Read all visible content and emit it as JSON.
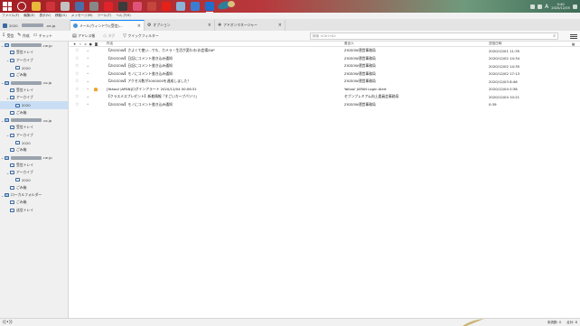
{
  "taskbar": {
    "apps": [
      {
        "icon": "folder-app-icon",
        "color": "#e8b93a"
      },
      {
        "icon": "red-app-icon",
        "color": "#d0343b"
      },
      {
        "icon": "tile-app-icon",
        "color": "#c2c2c2"
      },
      {
        "icon": "save-app-icon",
        "color": "#4a6fa8"
      },
      {
        "icon": "gear-app-icon",
        "color": "#888888"
      },
      {
        "icon": "opera-app-icon",
        "color": "#e1232a"
      },
      {
        "icon": "cmd-app-icon",
        "color": "#3b3b3b"
      },
      {
        "icon": "pink-app-icon",
        "color": "#e05277"
      },
      {
        "icon": "globe-app-icon",
        "color": "#c4463c"
      },
      {
        "icon": "youtube-app-icon",
        "color": "#e62117"
      },
      {
        "icon": "image-app-icon",
        "color": "#8ab4d8"
      },
      {
        "icon": "calendar-app-icon",
        "color": "#3c7dd4"
      },
      {
        "icon": "thunderbird-app-icon",
        "color": "#1f6fcf"
      }
    ],
    "ime": "A",
    "time": "0:40",
    "date": "2020/12/05"
  },
  "menubar": [
    "ファイル(F)",
    "編集(E)",
    "表示(V)",
    "移動(G)",
    "メッセージ(M)",
    "ツール(T)",
    "ヘルプ(H)"
  ],
  "tabs": [
    {
      "label": "2020",
      "suffix": ".ne.jp",
      "selected": false
    },
    {
      "label": "メール(ウィンドウ)(受信)…",
      "selected": true
    },
    {
      "label": "オプション",
      "selected": false
    },
    {
      "label": "アドオンマネージャー",
      "selected": false
    }
  ],
  "toolbar": {
    "buttons": [
      "受信",
      "作成",
      "チャット",
      "アドレス帳",
      "タグ",
      "クイックフィルター"
    ],
    "search_placeholder": "検索 <Ctrl+K>"
  },
  "folders": [
    {
      "level": 1,
      "type": "account",
      "suffix": ".ne.jp",
      "expanded": true
    },
    {
      "level": 2,
      "label": "受信トレイ"
    },
    {
      "level": 2,
      "label": "アーカイブ",
      "expanded": true
    },
    {
      "level": 3,
      "label": "2020"
    },
    {
      "level": 2,
      "label": "ごみ箱"
    },
    {
      "level": 1,
      "type": "account",
      "suffix": ".co.jp",
      "expanded": true
    },
    {
      "level": 2,
      "label": "受信トレイ"
    },
    {
      "level": 2,
      "label": "アーカイブ",
      "expanded": true
    },
    {
      "level": 3,
      "label": "2020",
      "selected": true
    },
    {
      "level": 2,
      "label": "ごみ箱"
    },
    {
      "level": 1,
      "type": "account",
      "suffix": ".co.jp",
      "expanded": true
    },
    {
      "level": 2,
      "label": "受信トレイ"
    },
    {
      "level": 2,
      "label": "アーカイブ",
      "expanded": true
    },
    {
      "level": 3,
      "label": "2020"
    },
    {
      "level": 2,
      "label": "ごみ箱"
    },
    {
      "level": 1,
      "type": "account",
      "suffix": ".ne.jp",
      "expanded": true
    },
    {
      "level": 2,
      "label": "受信トレイ"
    },
    {
      "level": 2,
      "label": "アーカイブ",
      "expanded": true
    },
    {
      "level": 3,
      "label": "2020"
    },
    {
      "level": 2,
      "label": "ごみ箱"
    },
    {
      "level": 1,
      "type": "local",
      "label": "ローカルフォルダー",
      "expanded": true
    },
    {
      "level": 2,
      "label": "ごみ箱"
    },
    {
      "level": 2,
      "label": "送信トレイ"
    }
  ],
  "columns": {
    "subject": "件名",
    "from": "差出人",
    "date": "送信日時"
  },
  "messages": [
    {
      "subject": "【ZIGSOW】さよくて使い…でも、カメラ・生活が変わる!お会場ZAP",
      "from": "ZIGSOW運営事務局",
      "date": "2020/12/01 11:35",
      "flag": false
    },
    {
      "subject": "【ZIGSOW】日記にコメント書き込み通知",
      "from": "ZIGSOW運営事務局",
      "date": "2020/12/02 14:34",
      "flag": false
    },
    {
      "subject": "【ZIGSOW】日記にコメント書き込み通知",
      "from": "ZIGSOW運営事務局",
      "date": "2020/12/02 14:35",
      "flag": false
    },
    {
      "subject": "【ZIGSOW】モノにコメント書き込み通知",
      "from": "ZIGSOW運営事務局",
      "date": "2020/12/02 17:13",
      "flag": false
    },
    {
      "subject": "【ZIGSOW】アクセス数が2000000を達成しました！",
      "from": "ZIGSOW運営事務局",
      "date": "2020/12/03 8:46",
      "flag": false
    },
    {
      "subject": "[Yahoo! JAPAN]ログインアラート 2020/12/04 00:06:31",
      "from": "Yahoo! JAPAN Login Alert",
      "date": "2020/12/04 0:38",
      "flag": true
    },
    {
      "subject": "【クラスメスプレゼント】新着情報「すごいカープパソリ」",
      "from": "セブンプレミアム向上委員会事務局",
      "date": "2020/12/04 10:21",
      "flag": false
    },
    {
      "subject": "【ZIGSOW】モノにコメント書き込み通知",
      "from": "ZIGSOW運営事務局",
      "date": "0:39",
      "flag": false
    }
  ],
  "status": {
    "unread": "未読数: 0",
    "total": "合計: 8"
  }
}
